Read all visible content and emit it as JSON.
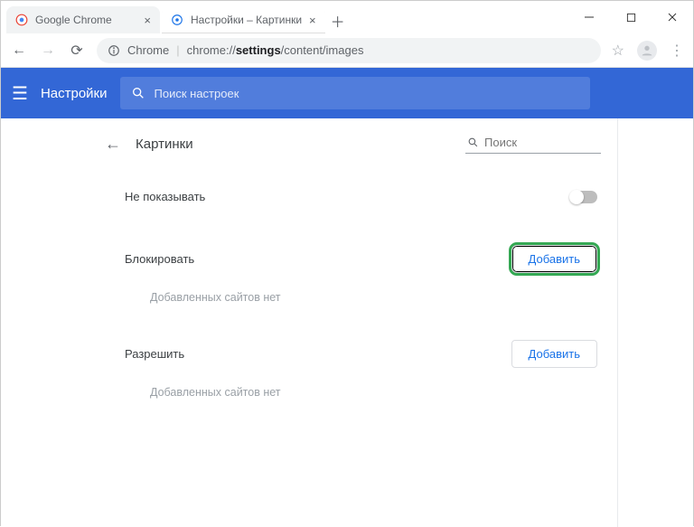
{
  "window": {
    "tabs": [
      {
        "title": "Google Chrome",
        "active": false
      },
      {
        "title": "Настройки – Картинки",
        "active": true
      }
    ]
  },
  "addressbar": {
    "scheme_label": "Chrome",
    "url_prefix": "chrome://",
    "url_bold": "settings",
    "url_rest": "/content/images"
  },
  "bluebar": {
    "title": "Настройки",
    "search_placeholder": "Поиск настроек"
  },
  "page": {
    "title": "Картинки",
    "search_placeholder": "Поиск",
    "toggle_label": "Не показывать",
    "block_section": {
      "label": "Блокировать",
      "button": "Добавить",
      "empty": "Добавленных сайтов нет"
    },
    "allow_section": {
      "label": "Разрешить",
      "button": "Добавить",
      "empty": "Добавленных сайтов нет"
    }
  }
}
